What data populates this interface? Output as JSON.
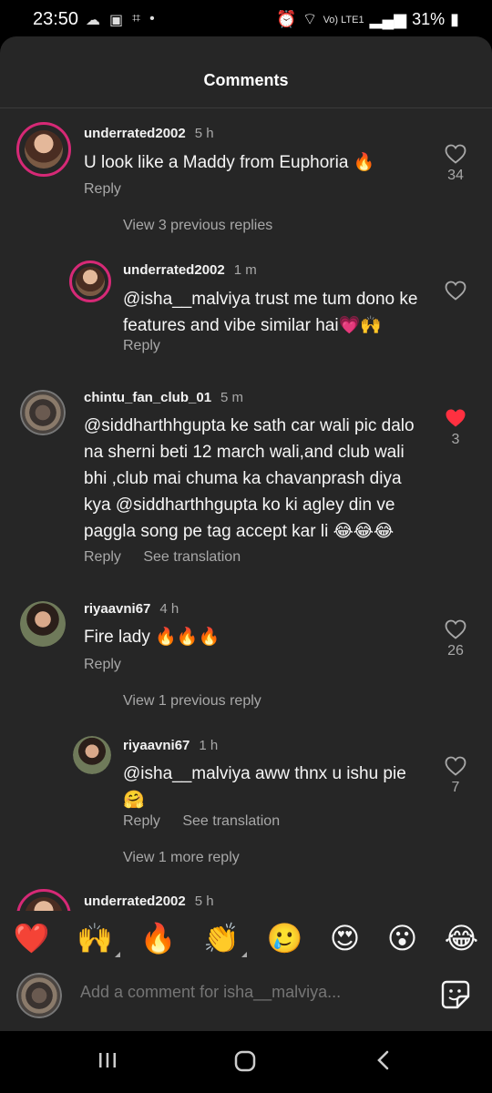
{
  "status": {
    "time": "23:50",
    "battery": "31%",
    "network": "Vo) LTE1"
  },
  "sheet": {
    "title": "Comments"
  },
  "comments": [
    {
      "user": "underrated2002",
      "time": "5 h",
      "text": "U look like a Maddy from Euphoria 🔥",
      "reply": "Reply",
      "likes": "34"
    },
    {
      "view_prev": "View 3 previous replies"
    },
    {
      "user": "underrated2002",
      "time": "1 m",
      "text": "@isha__malviya trust me tum dono ke features and vibe similar hai💗🙌",
      "reply": "Reply"
    },
    {
      "user": "chintu_fan_club_01",
      "time": "5 m",
      "text": "@siddharthhgupta ke sath car wali pic dalo na sherni beti  12 march wali,and club wali bhi ,club mai chuma ka chavanprash diya kya @siddharthhgupta ko ki agley din ve paggla song pe tag accept kar li 😂😂😂",
      "reply": "Reply",
      "translate": "See translation",
      "likes": "3"
    },
    {
      "user": "riyaavni67",
      "time": "4 h",
      "text": "Fire lady 🔥🔥🔥",
      "reply": "Reply",
      "likes": "26"
    },
    {
      "view_prev": "View 1 previous reply"
    },
    {
      "user": "riyaavni67",
      "time": "1 h",
      "text": "@isha__malviya aww thnx u ishu pie 🤗",
      "reply": "Reply",
      "translate": "See translation",
      "likes": "7"
    },
    {
      "view_more": "View 1 more reply"
    },
    {
      "user": "underrated2002",
      "time": "5 h"
    }
  ],
  "emojis": [
    "❤️",
    "🙌",
    "🔥",
    "👏",
    "🥲",
    "😍",
    "😮",
    "😂"
  ],
  "input": {
    "placeholder": "Add a comment for isha__malviya..."
  },
  "colors": {
    "sheet_bg": "#262626",
    "liked": "#ff3040",
    "secondary_text": "#a8a8a8"
  }
}
